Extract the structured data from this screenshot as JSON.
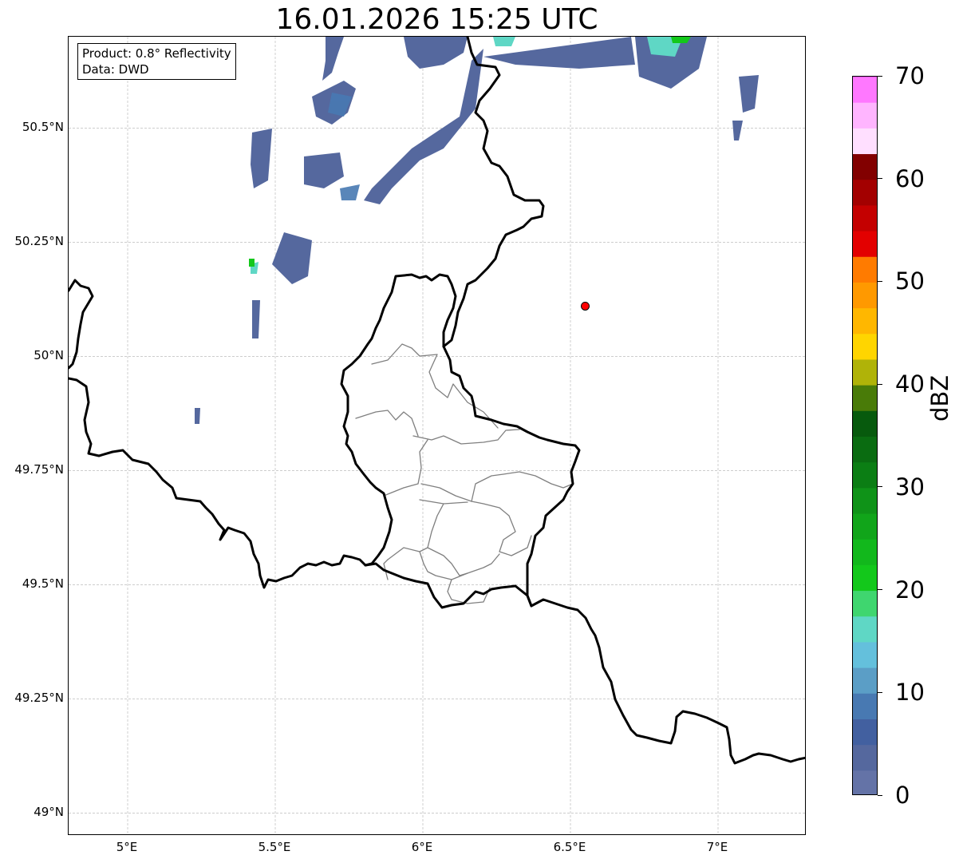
{
  "title": "16.01.2026 15:25 UTC",
  "info": {
    "product": "Product: 0.8° Reflectivity",
    "source": "Data: DWD"
  },
  "axes": {
    "lat_labels": [
      "50.5°N",
      "50.25°N",
      "50°N",
      "49.75°N",
      "49.5°N",
      "49.25°N",
      "49°N"
    ],
    "lon_labels": [
      "5°E",
      "5.5°E",
      "6°E",
      "6.5°E",
      "7°E"
    ],
    "lat_values": [
      50.5,
      50.25,
      50.0,
      49.75,
      49.5,
      49.25,
      49.0
    ],
    "lon_values": [
      5.0,
      5.5,
      6.0,
      6.5,
      7.0
    ],
    "extent": {
      "lon_min": 4.8,
      "lon_max": 7.3,
      "lat_min": 48.95,
      "lat_max": 50.7
    },
    "gridlines": true
  },
  "marker": {
    "lon": 6.55,
    "lat": 50.11,
    "color": "#ff0000"
  },
  "colorbar": {
    "unit": "dBZ",
    "min": 0,
    "max": 70,
    "tick_labels": [
      "0",
      "10",
      "20",
      "30",
      "40",
      "50",
      "60",
      "70"
    ],
    "tick_values": [
      0,
      10,
      20,
      30,
      40,
      50,
      60,
      70
    ],
    "colors": [
      "#6473a7",
      "#55689e",
      "#4260a0",
      "#4879b2",
      "#5b9ec6",
      "#64c0dc",
      "#5fd7c5",
      "#3fd66f",
      "#13c81b",
      "#12b81c",
      "#11a51a",
      "#0f9318",
      "#0b7e14",
      "#0a6c11",
      "#075a0d",
      "#497b08",
      "#b0b308",
      "#ffd500",
      "#ffb700",
      "#ff9900",
      "#ff7b00",
      "#e30000",
      "#c40000",
      "#a30000",
      "#820000",
      "#ffdfff",
      "#ffb5ff",
      "#ff78ff",
      "#eb38ec"
    ]
  },
  "colors": {
    "border_country": "#000000",
    "border_canton": "#7f7f7f",
    "grid": "#b0b0b0"
  }
}
